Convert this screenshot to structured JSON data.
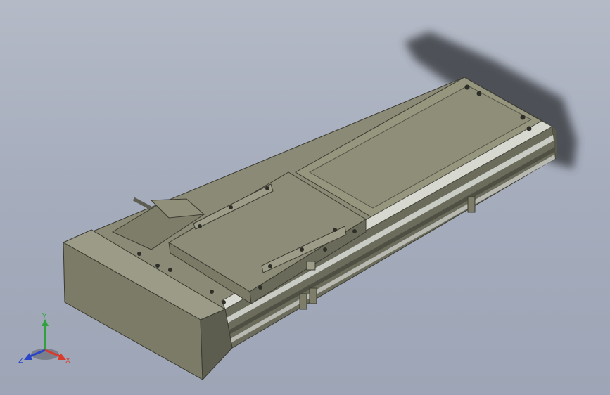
{
  "viewport": {
    "background_top": "#b4bac6",
    "background_bottom": "#9da5b6"
  },
  "model": {
    "body_color": "#8a8a76",
    "body_dark": "#5f5f50",
    "body_light": "#a3a38f",
    "rail_color": "#c9ccc4"
  },
  "triad": {
    "x_label": "X",
    "y_label": "Y",
    "z_label": "Z",
    "x_color": "#d93a2b",
    "y_color": "#2fa33b",
    "z_color": "#2a45c8"
  }
}
